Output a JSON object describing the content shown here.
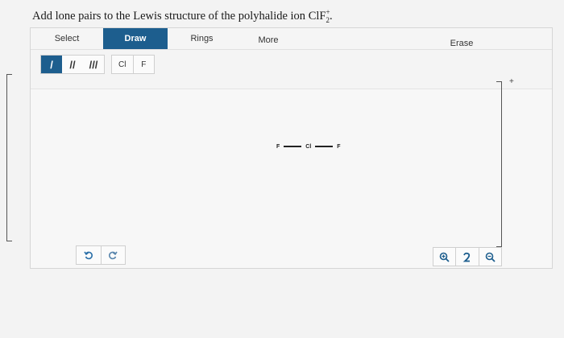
{
  "question": {
    "prefix": "Add lone pairs to the Lewis structure of the polyhalide ion ",
    "formula_base": "ClF",
    "formula_sup": "+",
    "formula_sub": "2",
    "suffix": "."
  },
  "toolbar": {
    "tabs": [
      {
        "label": "Select"
      },
      {
        "label": "Draw"
      },
      {
        "label": "Rings"
      },
      {
        "label": "More"
      },
      {
        "label": "Erase"
      }
    ],
    "active_tab": "Draw"
  },
  "bond_tools": [
    {
      "label": "/"
    },
    {
      "label": "//"
    },
    {
      "label": "///"
    }
  ],
  "atom_tools": [
    {
      "label": "Cl"
    },
    {
      "label": "F"
    }
  ],
  "molecule": {
    "left_atom": "F",
    "center_atom": "Cl",
    "right_atom": "F"
  },
  "charge": "+",
  "colors": {
    "accent": "#1d5e8e",
    "panel_bg": "#f7f7f7",
    "border": "#cfcfcf"
  }
}
